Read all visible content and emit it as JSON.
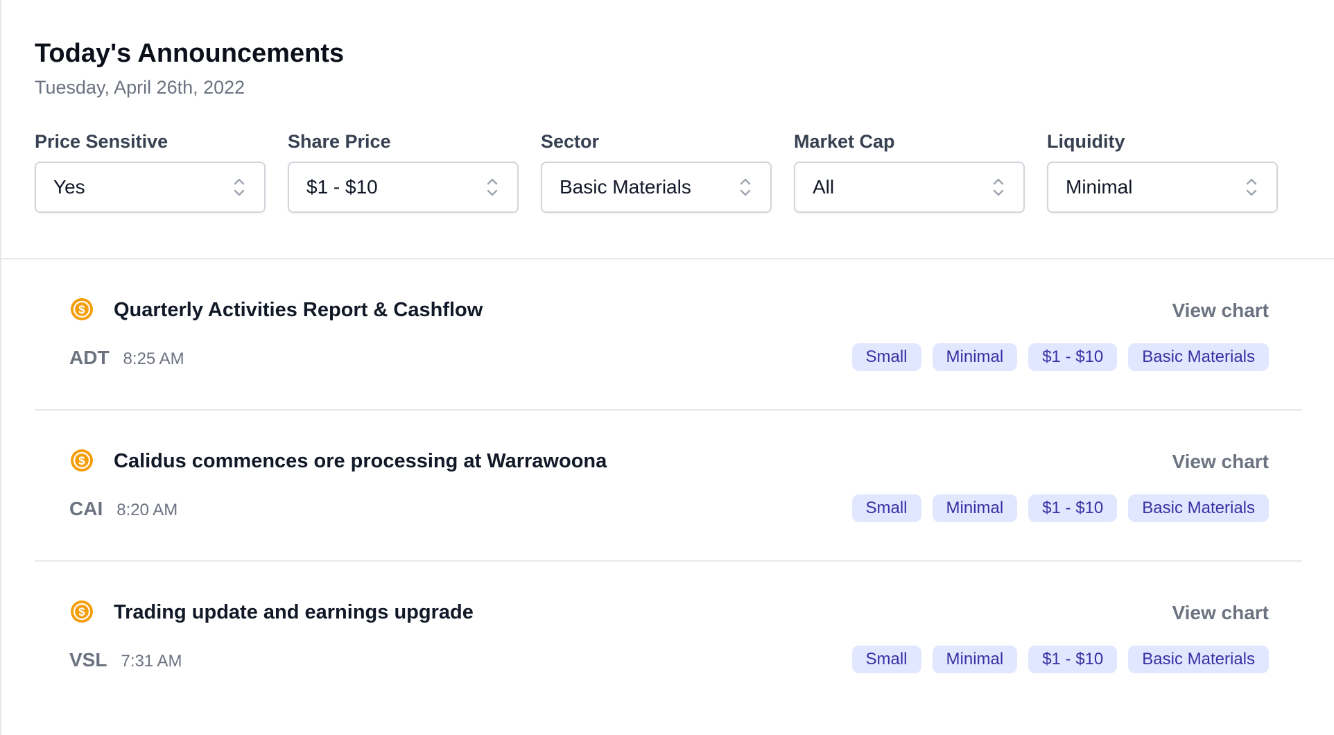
{
  "header": {
    "title": "Today's Announcements",
    "date": "Tuesday, April 26th, 2022"
  },
  "filters": [
    {
      "label": "Price Sensitive",
      "value": "Yes"
    },
    {
      "label": "Share Price",
      "value": "$1 - $10"
    },
    {
      "label": "Sector",
      "value": "Basic Materials"
    },
    {
      "label": "Market Cap",
      "value": "All"
    },
    {
      "label": "Liquidity",
      "value": "Minimal"
    }
  ],
  "announcements": [
    {
      "icon": "dollar-coin-icon",
      "headline": "Quarterly Activities Report & Cashflow",
      "ticker": "ADT",
      "time": "8:25 AM",
      "view_chart": "View chart",
      "tags": [
        "Small",
        "Minimal",
        "$1 - $10",
        "Basic Materials"
      ]
    },
    {
      "icon": "dollar-coin-icon",
      "headline": "Calidus commences ore processing at Warrawoona",
      "ticker": "CAI",
      "time": "8:20 AM",
      "view_chart": "View chart",
      "tags": [
        "Small",
        "Minimal",
        "$1 - $10",
        "Basic Materials"
      ]
    },
    {
      "icon": "dollar-coin-icon",
      "headline": "Trading update and earnings upgrade",
      "ticker": "VSL",
      "time": "7:31 AM",
      "view_chart": "View chart",
      "tags": [
        "Small",
        "Minimal",
        "$1 - $10",
        "Basic Materials"
      ]
    }
  ],
  "colors": {
    "accent_coin": "#f59e0b",
    "tag_bg": "#e0e7ff",
    "tag_text": "#3730a3",
    "muted_text": "#6b7280"
  }
}
